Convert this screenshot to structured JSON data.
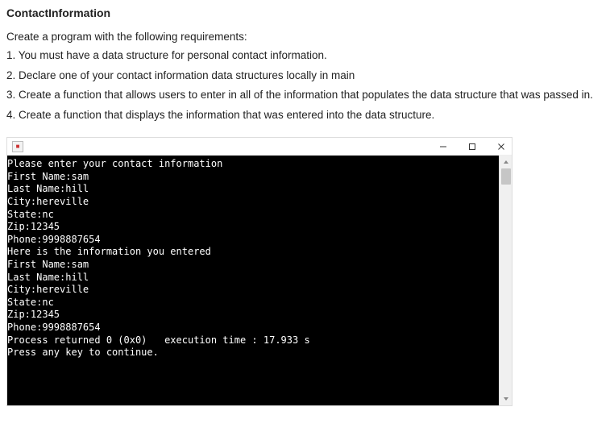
{
  "title": "ContactInformation",
  "intro": "Create a program with the following requirements:",
  "requirements": [
    "1. You must have a data structure for personal contact information.",
    "2. Declare one of your contact information data structures locally in main",
    "3. Create a function that allows users to enter in all of the information that populates the data structure that was passed in.",
    "4. Create a function that displays the information that was entered into the data structure."
  ],
  "console": {
    "icon_label": "",
    "lines": [
      "Please enter your contact information",
      "First Name:sam",
      "Last Name:hill",
      "City:hereville",
      "State:nc",
      "Zip:12345",
      "Phone:9998887654",
      "Here is the information you entered",
      "First Name:sam",
      "Last Name:hill",
      "City:hereville",
      "State:nc",
      "Zip:12345",
      "Phone:9998887654",
      "",
      "Process returned 0 (0x0)   execution time : 17.933 s",
      "Press any key to continue."
    ]
  }
}
